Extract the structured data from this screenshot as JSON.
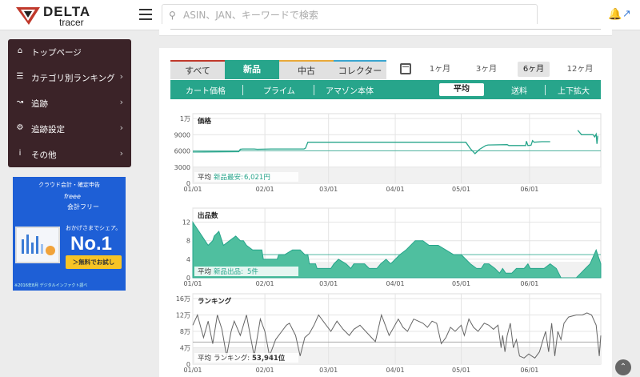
{
  "header": {
    "logo_word": "DELTA",
    "logo_sub": "tracer",
    "search_placeholder": "ASIN、JAN、キーワードで検索"
  },
  "sidebar": {
    "items": [
      {
        "label": "トップページ",
        "icon": "home-icon",
        "chevron": false
      },
      {
        "label": "カテゴリ別ランキング",
        "icon": "list-icon",
        "chevron": true
      },
      {
        "label": "追跡",
        "icon": "line-chart-icon",
        "chevron": true
      },
      {
        "label": "追跡設定",
        "icon": "gear-icon",
        "chevron": true
      },
      {
        "label": "その他",
        "icon": "info-icon",
        "chevron": true
      }
    ]
  },
  "ad": {
    "top": "クラウド会計・確定申告",
    "brand": "freee",
    "sub": "会計フリー",
    "share": "おかげさまでシェア。",
    "no1": "No.1",
    "button": "＞無料でお試し",
    "foot": "※2016年8月 デジタルインファクト調べ"
  },
  "tabs": {
    "all": "すべて",
    "new": "新品",
    "used": "中古",
    "collector": "コレクター"
  },
  "periods": [
    "1ヶ月",
    "3ヶ月",
    "6ヶ月",
    "12ヶ月"
  ],
  "active_period": "6ヶ月",
  "subbar": {
    "cart": "カート価格",
    "prime": "プライム",
    "amazon": "アマゾン本体",
    "average": "平均",
    "shipping": "送料",
    "zoom": "上下拡大"
  },
  "colors": {
    "accent": "#27a58b",
    "sidebar": "#3b2328",
    "rank_line": "#666666"
  },
  "chart_data": [
    {
      "type": "line",
      "title": "価格",
      "x_ticks": [
        "01/01",
        "02/01",
        "03/01",
        "04/01",
        "05/01",
        "06/01"
      ],
      "y_ticks": [
        "0",
        "3000",
        "6000",
        "9000",
        "1万"
      ],
      "ylim": [
        0,
        12000
      ],
      "average_text": "平均",
      "average_label": "新品最安:",
      "average_value": "6,021円",
      "average": 6021,
      "series": [
        {
          "values": [
            [
              0,
              5800
            ],
            [
              60,
              5850
            ],
            [
              62,
              6300
            ],
            [
              65,
              6350
            ],
            [
              80,
              6350
            ],
            [
              84,
              6300
            ],
            [
              102,
              6350
            ],
            [
              145,
              6350
            ],
            [
              147,
              6500
            ],
            [
              150,
              7600
            ],
            [
              185,
              7600
            ],
            [
              255,
              7600
            ],
            [
              300,
              7600
            ],
            [
              340,
              7600
            ],
            [
              356,
              7600
            ],
            [
              362,
              6400
            ],
            [
              368,
              5500
            ],
            [
              374,
              6300
            ],
            [
              382,
              7000
            ],
            [
              385,
              7100
            ],
            [
              410,
              7150
            ],
            [
              412,
              7000
            ],
            [
              434,
              7000
            ],
            [
              435,
              7800
            ],
            [
              437,
              7000
            ],
            [
              441,
              7050
            ],
            [
              443,
              7900
            ],
            [
              445,
              7600
            ],
            [
              455,
              7700
            ],
            [
              466,
              7700
            ]
          ]
        },
        {
          "values": [
            [
              502,
              9800
            ],
            [
              507,
              9000
            ],
            [
              515,
              9000
            ],
            [
              522,
              9000
            ],
            [
              524,
              8600
            ],
            [
              526,
              9100
            ],
            [
              527,
              7300
            ],
            [
              528,
              8800
            ]
          ]
        }
      ]
    },
    {
      "type": "area",
      "title": "出品数",
      "x_ticks": [
        "01/01",
        "02/01",
        "03/01",
        "04/01",
        "05/01",
        "06/01"
      ],
      "y_ticks": [
        "0",
        "4",
        "8",
        "12"
      ],
      "ylim": [
        0,
        14
      ],
      "average_text": "平均",
      "average_label": "新品出品:",
      "average_value": "5件",
      "average": 5,
      "series": [
        {
          "values": [
            [
              0,
              12
            ],
            [
              8,
              10
            ],
            [
              16,
              8
            ],
            [
              20,
              7
            ],
            [
              26,
              8
            ],
            [
              28,
              9
            ],
            [
              34,
              10
            ],
            [
              40,
              7
            ],
            [
              48,
              8
            ],
            [
              56,
              9
            ],
            [
              62,
              8
            ],
            [
              66,
              8
            ],
            [
              70,
              7
            ],
            [
              78,
              6
            ],
            [
              90,
              6
            ],
            [
              92,
              4
            ],
            [
              110,
              4
            ],
            [
              112,
              5
            ],
            [
              120,
              5
            ],
            [
              130,
              6
            ],
            [
              140,
              6
            ],
            [
              146,
              5
            ],
            [
              150,
              5
            ],
            [
              152,
              3
            ],
            [
              160,
              3
            ],
            [
              162,
              2
            ],
            [
              170,
              2
            ],
            [
              180,
              2
            ],
            [
              184,
              3
            ],
            [
              190,
              4
            ],
            [
              200,
              3
            ],
            [
              206,
              2
            ],
            [
              210,
              3
            ],
            [
              224,
              3
            ],
            [
              230,
              2
            ],
            [
              240,
              2
            ],
            [
              245,
              3
            ],
            [
              252,
              4
            ],
            [
              258,
              3
            ],
            [
              264,
              4
            ],
            [
              270,
              5
            ],
            [
              278,
              6
            ],
            [
              290,
              8
            ],
            [
              300,
              8
            ],
            [
              308,
              7
            ],
            [
              320,
              7
            ],
            [
              330,
              6
            ],
            [
              340,
              5
            ],
            [
              350,
              5
            ],
            [
              356,
              4
            ],
            [
              362,
              3
            ],
            [
              370,
              2
            ],
            [
              376,
              2
            ],
            [
              380,
              3
            ],
            [
              386,
              3
            ],
            [
              394,
              2
            ],
            [
              400,
              1
            ],
            [
              404,
              2
            ],
            [
              408,
              1
            ],
            [
              416,
              1
            ],
            [
              422,
              2
            ],
            [
              432,
              2
            ],
            [
              437,
              3
            ],
            [
              440,
              2
            ],
            [
              446,
              2
            ],
            [
              458,
              2
            ],
            [
              466,
              3
            ],
            [
              474,
              2
            ],
            [
              480,
              0
            ],
            [
              500,
              0
            ],
            [
              506,
              1
            ],
            [
              512,
              2
            ],
            [
              518,
              3
            ],
            [
              526,
              6
            ],
            [
              532,
              3
            ]
          ]
        }
      ]
    },
    {
      "type": "line",
      "title": "ランキング",
      "x_ticks": [
        "01/01",
        "02/01",
        "03/01",
        "04/01",
        "05/01",
        "06/01"
      ],
      "y_ticks": [
        "0",
        "4万",
        "8万",
        "12万",
        "16万"
      ],
      "ylim": [
        0,
        160000
      ],
      "average_text": "平均",
      "average_label": "ランキング:",
      "average_value": "53,941位",
      "average": 53941,
      "series": [
        {
          "values": [
            [
              0,
              95000
            ],
            [
              6,
              120000
            ],
            [
              14,
              65000
            ],
            [
              20,
              105000
            ],
            [
              26,
              50000
            ],
            [
              32,
              120000
            ],
            [
              38,
              85000
            ],
            [
              44,
              20000
            ],
            [
              50,
              80000
            ],
            [
              54,
              105000
            ],
            [
              62,
              70000
            ],
            [
              70,
              120000
            ],
            [
              80,
              20000
            ],
            [
              88,
              110000
            ],
            [
              94,
              80000
            ],
            [
              100,
              20000
            ],
            [
              108,
              60000
            ],
            [
              116,
              80000
            ],
            [
              122,
              95000
            ],
            [
              126,
              100000
            ],
            [
              134,
              70000
            ],
            [
              140,
              20000
            ],
            [
              146,
              65000
            ],
            [
              152,
              75000
            ],
            [
              158,
              95000
            ],
            [
              164,
              120000
            ],
            [
              172,
              100000
            ],
            [
              180,
              80000
            ],
            [
              188,
              105000
            ],
            [
              196,
              85000
            ],
            [
              204,
              70000
            ],
            [
              210,
              85000
            ],
            [
              218,
              95000
            ],
            [
              228,
              75000
            ],
            [
              238,
              55000
            ],
            [
              246,
              120000
            ],
            [
              250,
              100000
            ],
            [
              256,
              70000
            ],
            [
              262,
              90000
            ],
            [
              268,
              110000
            ],
            [
              274,
              90000
            ],
            [
              280,
              80000
            ],
            [
              288,
              110000
            ],
            [
              294,
              105000
            ],
            [
              300,
              100000
            ],
            [
              306,
              90000
            ],
            [
              312,
              105000
            ],
            [
              318,
              100000
            ],
            [
              324,
              50000
            ],
            [
              330,
              65000
            ],
            [
              336,
              90000
            ],
            [
              342,
              80000
            ],
            [
              350,
              95000
            ],
            [
              354,
              70000
            ],
            [
              360,
              110000
            ],
            [
              366,
              90000
            ],
            [
              372,
              80000
            ],
            [
              380,
              100000
            ],
            [
              386,
              95000
            ],
            [
              392,
              85000
            ],
            [
              398,
              95000
            ],
            [
              402,
              40000
            ],
            [
              404,
              70000
            ],
            [
              407,
              30000
            ],
            [
              410,
              70000
            ],
            [
              414,
              100000
            ],
            [
              418,
              40000
            ],
            [
              422,
              60000
            ],
            [
              426,
              20000
            ],
            [
              432,
              15000
            ],
            [
              438,
              25000
            ],
            [
              442,
              20000
            ],
            [
              446,
              15000
            ],
            [
              452,
              30000
            ],
            [
              456,
              55000
            ],
            [
              460,
              80000
            ],
            [
              464,
              30000
            ],
            [
              468,
              100000
            ],
            [
              472,
              20000
            ],
            [
              476,
              80000
            ],
            [
              480,
              60000
            ],
            [
              484,
              100000
            ],
            [
              490,
              115000
            ],
            [
              500,
              120000
            ],
            [
              508,
              120000
            ],
            [
              514,
              125000
            ],
            [
              520,
              120000
            ],
            [
              526,
              95000
            ],
            [
              530,
              20000
            ],
            [
              532,
              70000
            ]
          ]
        }
      ]
    }
  ]
}
